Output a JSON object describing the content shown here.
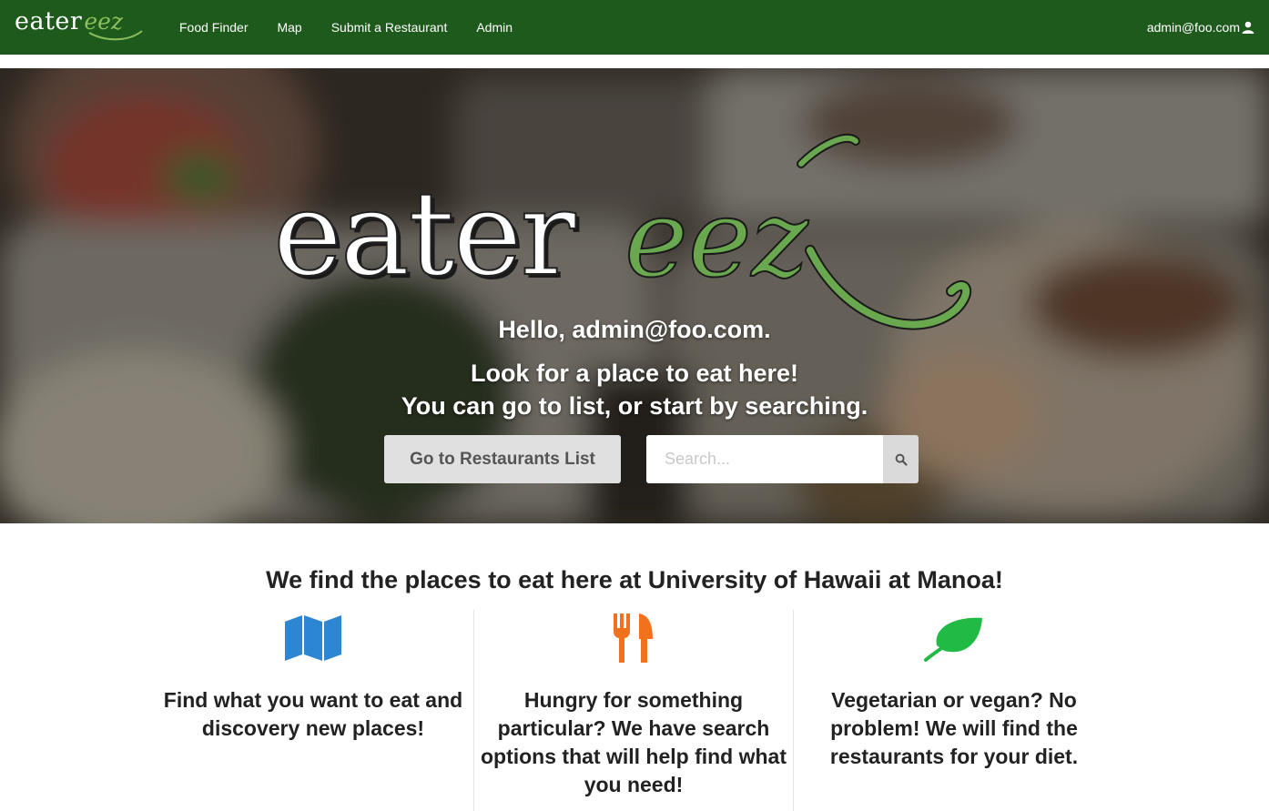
{
  "navbar": {
    "brand_main": "eater",
    "brand_accent": "eez",
    "links": [
      "Food Finder",
      "Map",
      "Submit a Restaurant",
      "Admin"
    ],
    "user_label": "admin@foo.com"
  },
  "hero": {
    "logo_main": "eater",
    "logo_accent": "eez",
    "greeting": "Hello, admin@foo.com.",
    "line1": "Look for a place to eat here!",
    "line2": "You can go to list, or start by searching.",
    "list_button": "Go to Restaurants List",
    "search_placeholder": "Search..."
  },
  "info": {
    "tagline": "We find the places to eat here at University of Hawaii at Manoa!",
    "columns": [
      {
        "icon": "map-icon",
        "color": "#2d86d4",
        "text": "Find what you want to eat and discovery new places!"
      },
      {
        "icon": "utensils-icon",
        "color": "#f2711c",
        "text": "Hungry for something particular? We have search options that will help find what you need!"
      },
      {
        "icon": "leaf-icon",
        "color": "#21ba45",
        "text": "Vegetarian or vegan? No problem! We will find the restaurants for your diet."
      }
    ]
  },
  "colors": {
    "navbar": "#1e5a1c",
    "accent_green": "#6aa84f"
  }
}
